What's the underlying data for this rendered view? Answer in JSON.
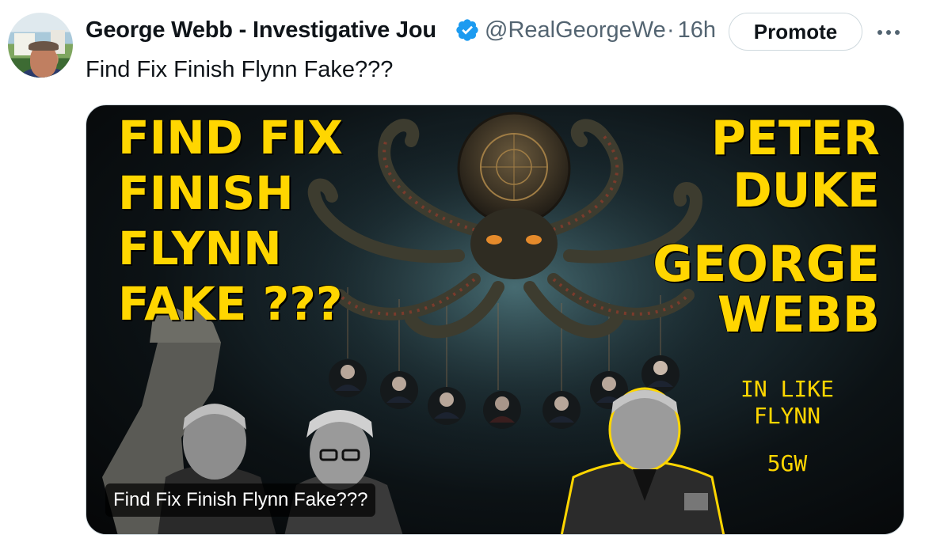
{
  "author": {
    "name": "George Webb - Investigative Jou",
    "handle": "@RealGeorgeWe",
    "separator": "·",
    "time": "16h",
    "verified_icon": "verified-badge-icon"
  },
  "actions": {
    "promote_label": "Promote",
    "more_icon": "more-horizontal-icon"
  },
  "tweet": {
    "text": "Find Fix Finish Flynn Fake???"
  },
  "media": {
    "title_lines": [
      "FIND FIX",
      "FINISH",
      "FLYNN",
      "FAKE ???"
    ],
    "right_names_top": [
      "PETER",
      "DUKE"
    ],
    "right_names_bottom": [
      "GEORGE",
      "WEBB"
    ],
    "tag_lines": [
      "IN LIKE",
      "FLYNN"
    ],
    "tag_bottom": "5GW",
    "caption": "Find Fix Finish Flynn Fake???"
  },
  "colors": {
    "accent_yellow": "#ffd600",
    "verified_blue": "#1d9bf0",
    "secondary_text": "#536471"
  }
}
